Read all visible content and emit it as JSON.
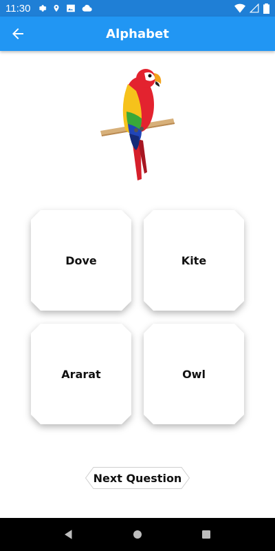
{
  "status": {
    "time": "11:30"
  },
  "appbar": {
    "title": "Alphabet"
  },
  "hero": {
    "image": "parrot-illustration"
  },
  "options": [
    "Dove",
    "Kite",
    "Ararat",
    "Owl"
  ],
  "next_label": "Next Question",
  "colors": {
    "appbar": "#2196f3",
    "statusbar": "#1f7fd6"
  }
}
